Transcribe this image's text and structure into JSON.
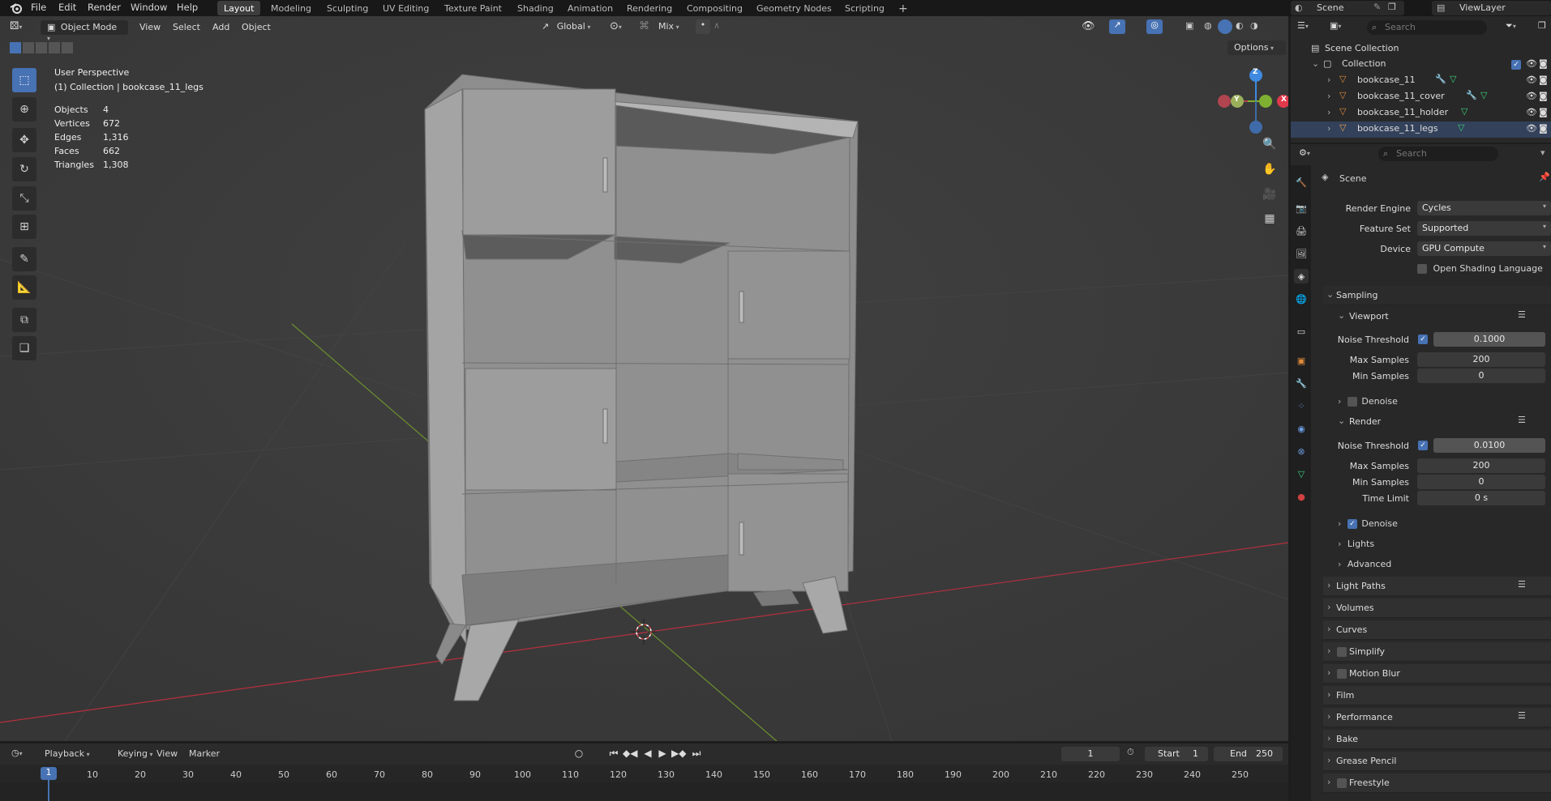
{
  "topbar": {
    "menus": [
      "File",
      "Edit",
      "Render",
      "Window",
      "Help"
    ],
    "workspaces": [
      "Layout",
      "Modeling",
      "Sculpting",
      "UV Editing",
      "Texture Paint",
      "Shading",
      "Animation",
      "Rendering",
      "Compositing",
      "Geometry Nodes",
      "Scripting"
    ],
    "add_tab": "+",
    "scene": "Scene",
    "view_layer": "ViewLayer"
  },
  "viewport": {
    "mode": "Object Mode",
    "menus": [
      "View",
      "Select",
      "Add",
      "Object"
    ],
    "orientation": "Global",
    "proportional": "Mix",
    "options": "Options",
    "perspective": "User Perspective",
    "collection_info": "(1) Collection | bookcase_11_legs",
    "stats": [
      {
        "label": "Objects",
        "value": "4"
      },
      {
        "label": "Vertices",
        "value": "672"
      },
      {
        "label": "Edges",
        "value": "1,316"
      },
      {
        "label": "Faces",
        "value": "662"
      },
      {
        "label": "Triangles",
        "value": "1,308"
      }
    ],
    "gizmo": {
      "z": "Z",
      "y": "Y",
      "x": "X"
    }
  },
  "outliner": {
    "search_placeholder": "Search",
    "scene_collection": "Scene Collection",
    "collection": "Collection",
    "items": [
      "bookcase_11",
      "bookcase_11_cover",
      "bookcase_11_holder",
      "bookcase_11_legs"
    ]
  },
  "properties": {
    "search_placeholder": "Search",
    "context": "Scene",
    "render_engine_label": "Render Engine",
    "render_engine": "Cycles",
    "feature_set_label": "Feature Set",
    "feature_set": "Supported",
    "device_label": "Device",
    "device": "GPU Compute",
    "osl_label": "Open Shading Language",
    "sampling": "Sampling",
    "viewport": {
      "title": "Viewport",
      "noise_threshold_label": "Noise Threshold",
      "noise_threshold": "0.1000",
      "max_samples_label": "Max Samples",
      "max_samples": "200",
      "min_samples_label": "Min Samples",
      "min_samples": "0",
      "denoise": "Denoise"
    },
    "render": {
      "title": "Render",
      "noise_threshold_label": "Noise Threshold",
      "noise_threshold": "0.0100",
      "max_samples_label": "Max Samples",
      "max_samples": "200",
      "min_samples_label": "Min Samples",
      "min_samples": "0",
      "time_limit_label": "Time Limit",
      "time_limit": "0 s",
      "denoise": "Denoise"
    },
    "lights": "Lights",
    "advanced": "Advanced",
    "sections": [
      "Light Paths",
      "Volumes",
      "Curves",
      "Simplify",
      "Motion Blur",
      "Film",
      "Performance",
      "Bake",
      "Grease Pencil",
      "Freestyle"
    ]
  },
  "timeline": {
    "menus": [
      "Playback",
      "Keying",
      "View",
      "Marker"
    ],
    "current_frame": "1",
    "start_label": "Start",
    "start": "1",
    "end_label": "End",
    "end": "250",
    "ticks": [
      "1",
      "10",
      "20",
      "30",
      "40",
      "50",
      "60",
      "70",
      "80",
      "90",
      "100",
      "110",
      "120",
      "130",
      "140",
      "150",
      "160",
      "170",
      "180",
      "190",
      "200",
      "210",
      "220",
      "230",
      "240",
      "250"
    ]
  },
  "colors": {
    "accent": "#4772b3",
    "viewport_bg": "#3b3b3b",
    "panel_bg": "#282828",
    "x_axis": "#e0394b",
    "y_axis": "#7fb032",
    "z_axis": "#3f8ae0"
  }
}
